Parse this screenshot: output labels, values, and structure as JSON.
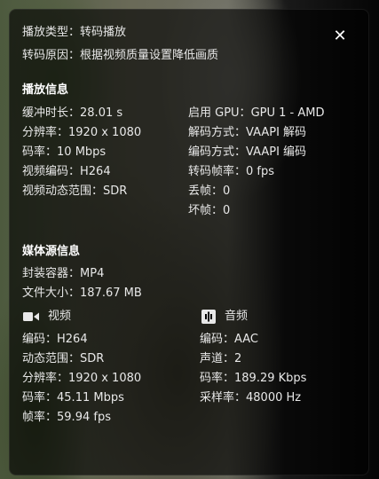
{
  "playback": {
    "type_label": "播放类型：",
    "type_value": "转码播放",
    "reason_label": "转码原因：",
    "reason_value": "根据视频质量设置降低画质"
  },
  "close_icon": "close-icon",
  "playback_info": {
    "title": "播放信息",
    "left": [
      {
        "label": "缓冲时长：",
        "value": "28.01 s"
      },
      {
        "label": "分辨率：",
        "value": "1920 x 1080"
      },
      {
        "label": "码率：",
        "value": "10 Mbps"
      },
      {
        "label": "视频编码：",
        "value": "H264"
      },
      {
        "label": "视频动态范围：",
        "value": "SDR"
      }
    ],
    "right": [
      {
        "label": "启用 GPU：",
        "value": "GPU 1 - AMD"
      },
      {
        "label": "解码方式：",
        "value": "VAAPI 解码"
      },
      {
        "label": "编码方式：",
        "value": "VAAPI 编码"
      },
      {
        "label": "转码帧率：",
        "value": "0 fps"
      },
      {
        "label": "丢帧：",
        "value": "0"
      },
      {
        "label": "坏帧：",
        "value": "0"
      }
    ]
  },
  "media_info": {
    "title": "媒体源信息",
    "container_label": "封装容器：",
    "container_value": "MP4",
    "size_label": "文件大小：",
    "size_value": "187.67 MB",
    "video": {
      "title": "视频",
      "icon": "video-camera-icon",
      "rows": [
        {
          "label": "编码：",
          "value": "H264"
        },
        {
          "label": "动态范围：",
          "value": "SDR"
        },
        {
          "label": "分辨率：",
          "value": "1920 x 1080"
        },
        {
          "label": "码率：",
          "value": "45.11 Mbps"
        },
        {
          "label": "帧率：",
          "value": "59.94 fps"
        }
      ]
    },
    "audio": {
      "title": "音频",
      "icon": "audio-wave-icon",
      "rows": [
        {
          "label": "编码：",
          "value": "AAC"
        },
        {
          "label": "声道：",
          "value": "2"
        },
        {
          "label": "码率：",
          "value": "189.29 Kbps"
        },
        {
          "label": "采样率：",
          "value": "48000 Hz"
        }
      ]
    }
  }
}
